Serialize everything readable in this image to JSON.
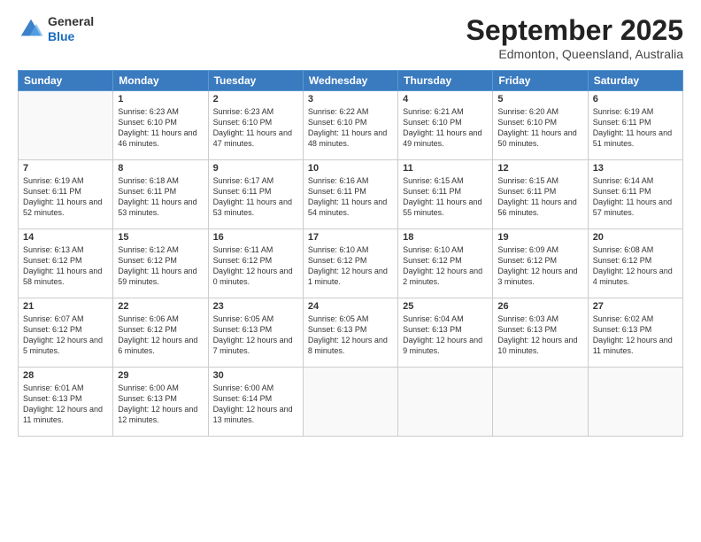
{
  "header": {
    "logo_general": "General",
    "logo_blue": "Blue",
    "month": "September 2025",
    "location": "Edmonton, Queensland, Australia"
  },
  "days_of_week": [
    "Sunday",
    "Monday",
    "Tuesday",
    "Wednesday",
    "Thursday",
    "Friday",
    "Saturday"
  ],
  "weeks": [
    [
      {
        "day": "",
        "info": ""
      },
      {
        "day": "1",
        "info": "Sunrise: 6:23 AM\nSunset: 6:10 PM\nDaylight: 11 hours and 46 minutes."
      },
      {
        "day": "2",
        "info": "Sunrise: 6:23 AM\nSunset: 6:10 PM\nDaylight: 11 hours and 47 minutes."
      },
      {
        "day": "3",
        "info": "Sunrise: 6:22 AM\nSunset: 6:10 PM\nDaylight: 11 hours and 48 minutes."
      },
      {
        "day": "4",
        "info": "Sunrise: 6:21 AM\nSunset: 6:10 PM\nDaylight: 11 hours and 49 minutes."
      },
      {
        "day": "5",
        "info": "Sunrise: 6:20 AM\nSunset: 6:10 PM\nDaylight: 11 hours and 50 minutes."
      },
      {
        "day": "6",
        "info": "Sunrise: 6:19 AM\nSunset: 6:11 PM\nDaylight: 11 hours and 51 minutes."
      }
    ],
    [
      {
        "day": "7",
        "info": "Sunrise: 6:19 AM\nSunset: 6:11 PM\nDaylight: 11 hours and 52 minutes."
      },
      {
        "day": "8",
        "info": "Sunrise: 6:18 AM\nSunset: 6:11 PM\nDaylight: 11 hours and 53 minutes."
      },
      {
        "day": "9",
        "info": "Sunrise: 6:17 AM\nSunset: 6:11 PM\nDaylight: 11 hours and 53 minutes."
      },
      {
        "day": "10",
        "info": "Sunrise: 6:16 AM\nSunset: 6:11 PM\nDaylight: 11 hours and 54 minutes."
      },
      {
        "day": "11",
        "info": "Sunrise: 6:15 AM\nSunset: 6:11 PM\nDaylight: 11 hours and 55 minutes."
      },
      {
        "day": "12",
        "info": "Sunrise: 6:15 AM\nSunset: 6:11 PM\nDaylight: 11 hours and 56 minutes."
      },
      {
        "day": "13",
        "info": "Sunrise: 6:14 AM\nSunset: 6:11 PM\nDaylight: 11 hours and 57 minutes."
      }
    ],
    [
      {
        "day": "14",
        "info": "Sunrise: 6:13 AM\nSunset: 6:12 PM\nDaylight: 11 hours and 58 minutes."
      },
      {
        "day": "15",
        "info": "Sunrise: 6:12 AM\nSunset: 6:12 PM\nDaylight: 11 hours and 59 minutes."
      },
      {
        "day": "16",
        "info": "Sunrise: 6:11 AM\nSunset: 6:12 PM\nDaylight: 12 hours and 0 minutes."
      },
      {
        "day": "17",
        "info": "Sunrise: 6:10 AM\nSunset: 6:12 PM\nDaylight: 12 hours and 1 minute."
      },
      {
        "day": "18",
        "info": "Sunrise: 6:10 AM\nSunset: 6:12 PM\nDaylight: 12 hours and 2 minutes."
      },
      {
        "day": "19",
        "info": "Sunrise: 6:09 AM\nSunset: 6:12 PM\nDaylight: 12 hours and 3 minutes."
      },
      {
        "day": "20",
        "info": "Sunrise: 6:08 AM\nSunset: 6:12 PM\nDaylight: 12 hours and 4 minutes."
      }
    ],
    [
      {
        "day": "21",
        "info": "Sunrise: 6:07 AM\nSunset: 6:12 PM\nDaylight: 12 hours and 5 minutes."
      },
      {
        "day": "22",
        "info": "Sunrise: 6:06 AM\nSunset: 6:12 PM\nDaylight: 12 hours and 6 minutes."
      },
      {
        "day": "23",
        "info": "Sunrise: 6:05 AM\nSunset: 6:13 PM\nDaylight: 12 hours and 7 minutes."
      },
      {
        "day": "24",
        "info": "Sunrise: 6:05 AM\nSunset: 6:13 PM\nDaylight: 12 hours and 8 minutes."
      },
      {
        "day": "25",
        "info": "Sunrise: 6:04 AM\nSunset: 6:13 PM\nDaylight: 12 hours and 9 minutes."
      },
      {
        "day": "26",
        "info": "Sunrise: 6:03 AM\nSunset: 6:13 PM\nDaylight: 12 hours and 10 minutes."
      },
      {
        "day": "27",
        "info": "Sunrise: 6:02 AM\nSunset: 6:13 PM\nDaylight: 12 hours and 11 minutes."
      }
    ],
    [
      {
        "day": "28",
        "info": "Sunrise: 6:01 AM\nSunset: 6:13 PM\nDaylight: 12 hours and 11 minutes."
      },
      {
        "day": "29",
        "info": "Sunrise: 6:00 AM\nSunset: 6:13 PM\nDaylight: 12 hours and 12 minutes."
      },
      {
        "day": "30",
        "info": "Sunrise: 6:00 AM\nSunset: 6:14 PM\nDaylight: 12 hours and 13 minutes."
      },
      {
        "day": "",
        "info": ""
      },
      {
        "day": "",
        "info": ""
      },
      {
        "day": "",
        "info": ""
      },
      {
        "day": "",
        "info": ""
      }
    ]
  ]
}
